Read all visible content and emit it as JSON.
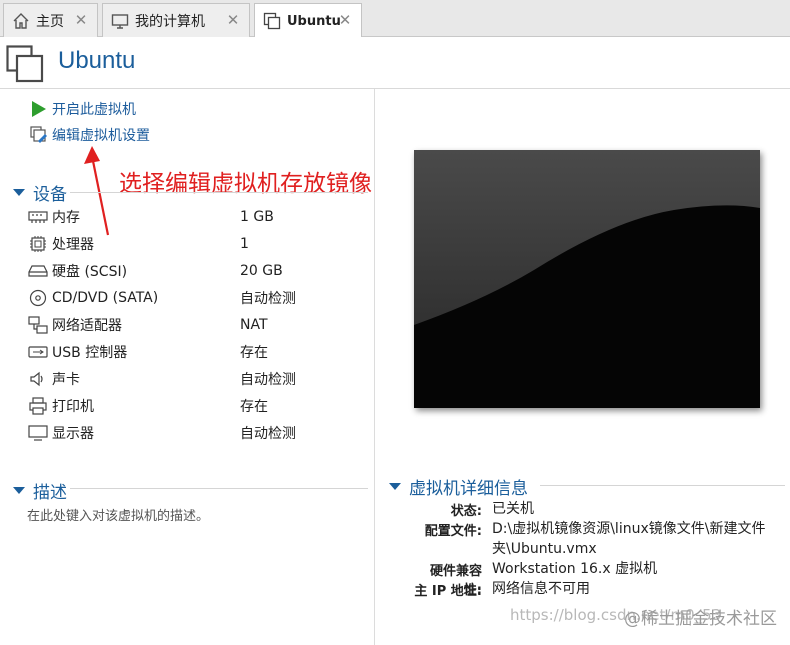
{
  "tabs": [
    {
      "label": "主页",
      "icon": "home-icon"
    },
    {
      "label": "我的计算机",
      "icon": "monitor-icon"
    },
    {
      "label": "Ubuntu",
      "icon": "vm-icon"
    }
  ],
  "header": {
    "title": "Ubuntu"
  },
  "actions": {
    "power_on": "开启此虚拟机",
    "edit_settings": "编辑虚拟机设置"
  },
  "annotation": "选择编辑虚拟机存放镜像",
  "devices": {
    "title": "设备",
    "items": [
      {
        "name": "内存",
        "value": "1 GB",
        "icon": "memory-icon"
      },
      {
        "name": "处理器",
        "value": "1",
        "icon": "cpu-icon"
      },
      {
        "name": "硬盘 (SCSI)",
        "value": "20 GB",
        "icon": "hard-disk-icon"
      },
      {
        "name": "CD/DVD (SATA)",
        "value": "自动检测",
        "icon": "cd-dvd-icon"
      },
      {
        "name": "网络适配器",
        "value": "NAT",
        "icon": "network-adapter-icon"
      },
      {
        "name": "USB 控制器",
        "value": "存在",
        "icon": "usb-icon"
      },
      {
        "name": "声卡",
        "value": "自动检测",
        "icon": "speaker-icon"
      },
      {
        "name": "打印机",
        "value": "存在",
        "icon": "printer-icon"
      },
      {
        "name": "显示器",
        "value": "自动检测",
        "icon": "display-icon"
      }
    ]
  },
  "description": {
    "title": "描述",
    "placeholder": "在此处键入对该虚拟机的描述。"
  },
  "details": {
    "title": "虚拟机详细信息",
    "status_label": "状态:",
    "status_value": "已关机",
    "config_label": "配置文件:",
    "config_value_1": "D:\\虚拟机镜像资源\\linux镜像文件\\新建文件",
    "config_value_2": "夹\\Ubuntu.vmx",
    "compat_label": "硬件兼容性:",
    "compat_value": "Workstation 16.x 虚拟机",
    "ip_label": "主 IP 地址:",
    "ip_value": "网络信息不可用"
  },
  "watermark": {
    "faded": "https://blog.csdn.net/m0_53",
    "brand": "@稀土掘金技术社区"
  },
  "colors": {
    "accent": "#1b5e9b",
    "annotation": "#e02020",
    "play_green": "#2e9e2e"
  }
}
